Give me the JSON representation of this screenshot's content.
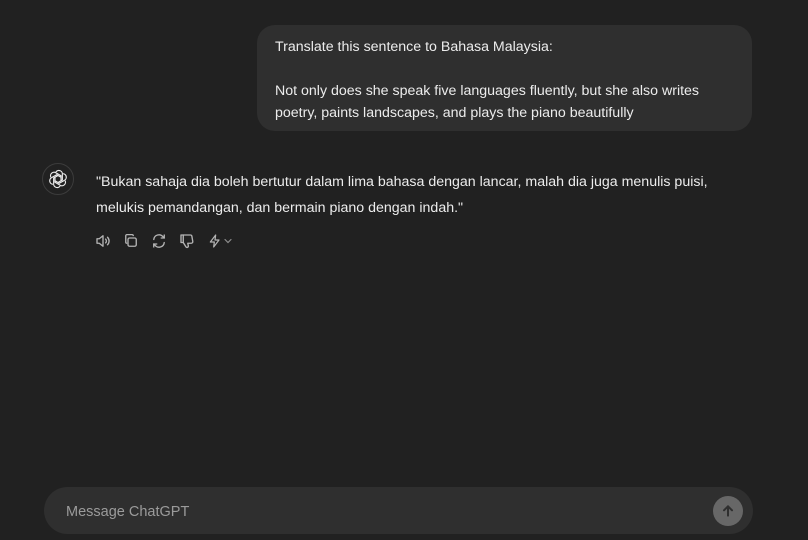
{
  "user_message": {
    "line1": "Translate this sentence to Bahasa Malaysia:",
    "line2": "Not only does she speak five languages fluently, but she also writes",
    "line3": "poetry, paints landscapes, and plays the piano beautifully"
  },
  "assistant_message": {
    "line1": "\"Bukan sahaja dia boleh bertutur dalam lima bahasa dengan lancar, malah dia juga menulis puisi,",
    "line2": "melukis pemandangan, dan bermain piano dengan indah.\""
  },
  "actions": {
    "icons": [
      "read-aloud-icon",
      "copy-icon",
      "regenerate-icon",
      "thumbs-down-icon",
      "switch-model-icon",
      "chevron-down-icon"
    ]
  },
  "composer": {
    "placeholder": "Message ChatGPT",
    "value": ""
  },
  "colors": {
    "background": "#212121",
    "bubble": "#2f2f2f",
    "text": "#ececec",
    "muted": "#9b9b9b",
    "send_button": "#676767"
  }
}
